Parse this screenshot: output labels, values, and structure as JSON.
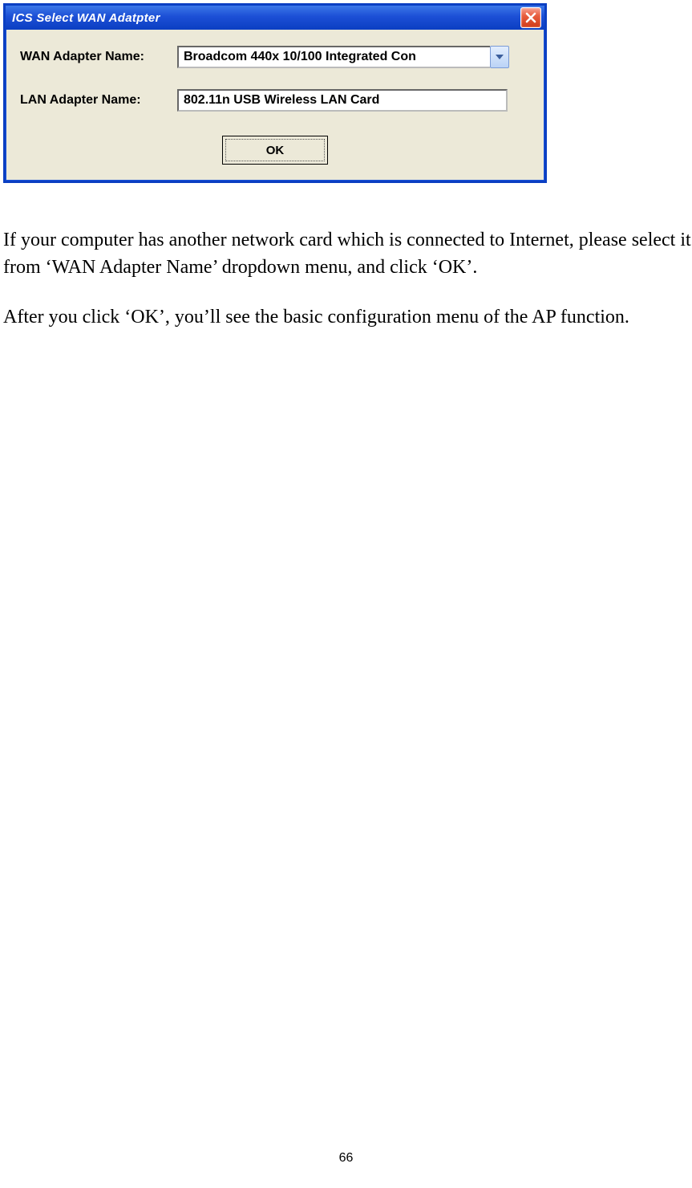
{
  "dialog": {
    "title": "ICS Select WAN Adatpter",
    "wan_label": "WAN Adapter Name:",
    "wan_value": "Broadcom 440x 10/100 Integrated Con",
    "lan_label": "LAN Adapter Name:",
    "lan_value": "802.11n USB Wireless LAN Card",
    "ok_label": "OK"
  },
  "text": {
    "para1": "If your computer has another network card which is connected to Internet, please select it from ‘WAN Adapter Name’ dropdown menu, and click ‘OK’.",
    "para2": "After you click ‘OK’, you’ll see the basic configuration menu of the AP function."
  },
  "page_number": "66"
}
